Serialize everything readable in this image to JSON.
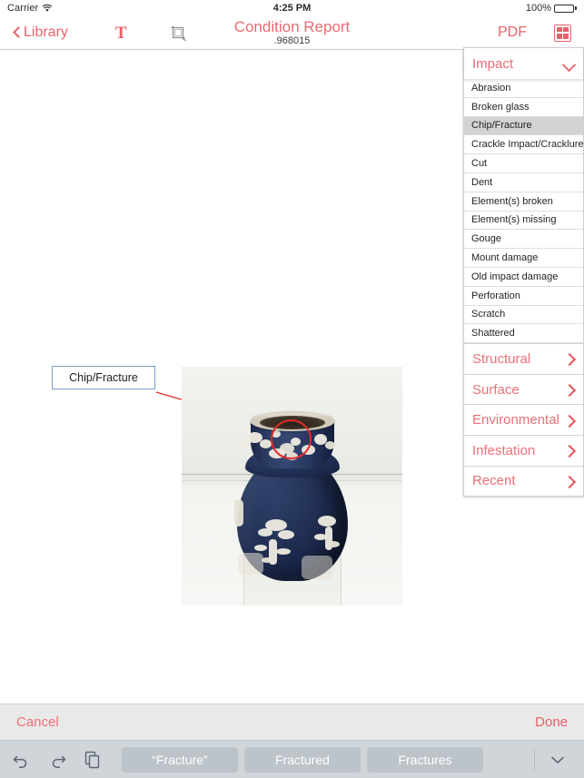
{
  "status_bar": {
    "carrier": "Carrier",
    "wifi_icon": "wifi-icon",
    "time": "4:25 PM",
    "battery_percent": "100%",
    "battery_icon": "battery-full-icon"
  },
  "nav_bar": {
    "back_label": "Library",
    "back_icon": "chevron-left-icon",
    "text_tool_label": "T",
    "crop_tool_icon": "crop-icon",
    "title": "Condition Report",
    "subtitle": ".968015",
    "pdf_label": "PDF",
    "grid_icon": "grid-four-squares-icon"
  },
  "canvas": {
    "annotation_label": "Chip/Fracture",
    "circle_annotation_icon": "red-circle-annotation",
    "leader_line_icon": "leader-line",
    "photo_alt": "dark-blue-jasperware-vase-photo"
  },
  "category_panel": {
    "header": {
      "title": "Impact",
      "chevron_icon": "chevron-down-icon"
    },
    "options": [
      "Abrasion",
      "Broken glass",
      "Chip/Fracture",
      "Crackle Impact/Cracklure",
      "Cut",
      "Dent",
      "Element(s) broken",
      "Element(s) missing",
      "Gouge",
      "Mount damage",
      "Old impact damage",
      "Perforation",
      "Scratch",
      "Shattered"
    ],
    "selected_option": "Chip/Fracture",
    "categories": [
      {
        "label": "Structural",
        "chevron_icon": "chevron-right-icon"
      },
      {
        "label": "Surface",
        "chevron_icon": "chevron-right-icon"
      },
      {
        "label": "Environmental",
        "chevron_icon": "chevron-right-icon"
      },
      {
        "label": "Infestation",
        "chevron_icon": "chevron-right-icon"
      },
      {
        "label": "Recent",
        "chevron_icon": "chevron-right-icon"
      }
    ]
  },
  "action_bar": {
    "cancel_label": "Cancel",
    "done_label": "Done"
  },
  "keyboard_bar": {
    "undo_icon": "undo-arrow-icon",
    "redo_icon": "redo-arrow-icon",
    "paste_icon": "paste-clipboard-icon",
    "suggestions": [
      "“Fracture”",
      "Fractured",
      "Fractures"
    ],
    "dismiss_icon": "chevron-down-dismiss-keyboard-icon"
  },
  "colors": {
    "accent_red": "#ec6b72",
    "accent_red_strong": "#e02a2a",
    "selected_row": "#d3d3d3",
    "keyboard_bg": "#d0d5da",
    "action_bar_bg": "#e9e9e9",
    "label_border_blue": "#7a9cc4",
    "vase_navy": "#1b2749",
    "vase_relief_white": "#efece1"
  }
}
